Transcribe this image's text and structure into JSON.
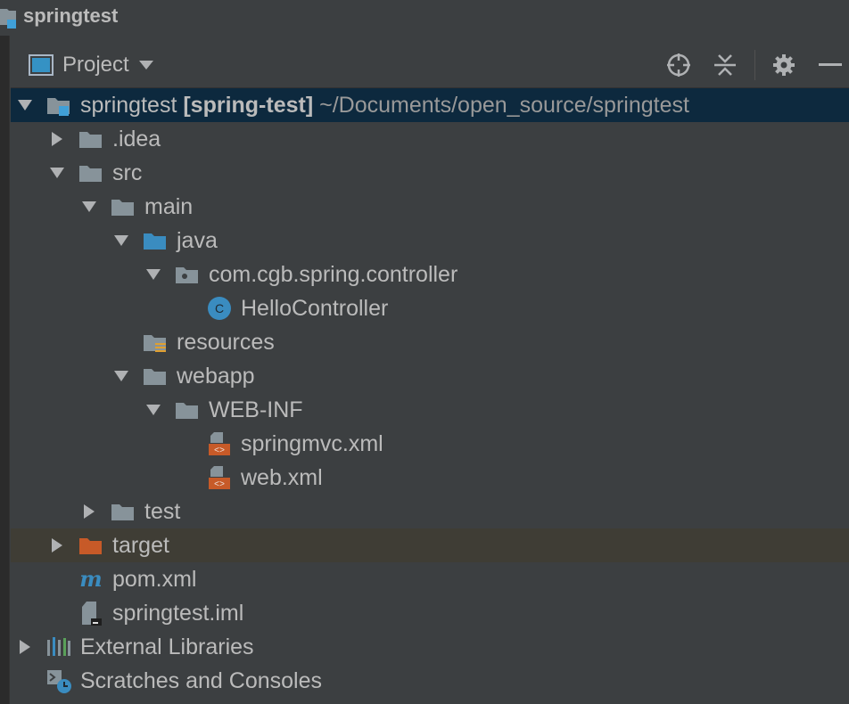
{
  "window": {
    "title": "springtest"
  },
  "panel": {
    "title": "Project"
  },
  "tree": {
    "root": {
      "name": "springtest",
      "module": "[spring-test]",
      "path": "~/Documents/open_source/springtest"
    },
    "idea": ".idea",
    "src": "src",
    "main": "main",
    "java": "java",
    "package": "com.cgb.spring.controller",
    "controller": "HelloController",
    "resources": "resources",
    "webapp": "webapp",
    "webinf": "WEB-INF",
    "springmvc": "springmvc.xml",
    "webxml": "web.xml",
    "test": "test",
    "target": "target",
    "pom": "pom.xml",
    "iml": "springtest.iml",
    "libraries": "External Libraries",
    "scratches": "Scratches and Consoles"
  },
  "colors": {
    "accent": "#3592c4",
    "folder": "#87939a",
    "excluded": "#c75a28",
    "xml": "#c75a28",
    "selection": "#0d293e"
  }
}
